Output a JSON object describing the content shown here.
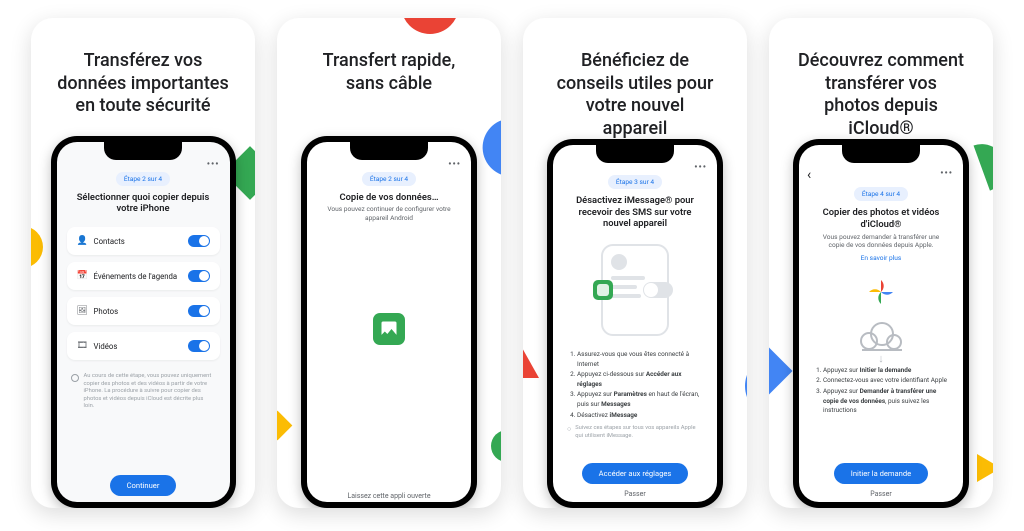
{
  "cards": [
    {
      "headline": "Transférez vos\ndonnées importantes\nen toute sécurité",
      "step": "Étape 2 sur 4",
      "title": "Sélectionner quoi copier depuis votre iPhone",
      "note": "Au cours de cette étape, vous pouvez uniquement copier des photos et des vidéos à partir de votre iPhone. La procédure à suivre pour copier des photos et vidéos depuis iCloud est décrite plus loin.",
      "cta": "Continuer",
      "toggles": [
        {
          "icon": "👤",
          "label": "Contacts",
          "on": true
        },
        {
          "icon": "📅",
          "label": "Événements de l'agenda",
          "on": true
        },
        {
          "icon": "🖼",
          "label": "Photos",
          "on": true
        },
        {
          "icon": "🎞",
          "label": "Vidéos",
          "on": true
        }
      ]
    },
    {
      "headline": "Transfert rapide,\nsans câble",
      "step": "Étape 2 sur 4",
      "title": "Copie de vos données…",
      "sub": "Vous pouvez continuer de configurer votre appareil Android",
      "bottom": "Laissez cette appli ouverte"
    },
    {
      "headline": "Bénéficiez de\nconseils utiles pour\nvotre nouvel\nappareil",
      "step": "Étape 3 sur 4",
      "title": "Désactivez iMessage® pour recevoir des SMS sur votre nouvel appareil",
      "list": [
        "Assurez-vous que vous êtes connecté à Internet",
        "Appuyez ci-dessous sur <b>Accéder aux réglages</b>",
        "Appuyez sur <b>Paramètres</b> en haut de l'écran, puis sur <b>Messages</b>",
        "Désactivez <b>iMessage</b>"
      ],
      "subnote": "Suivez ces étapes sur tous vos appareils Apple qui utilisent iMessage.",
      "cta": "Accéder aux réglages",
      "skip": "Passer"
    },
    {
      "headline": "Découvrez comment\ntransférer vos\nphotos depuis\niCloud®",
      "step": "Étape 4 sur 4",
      "title": "Copier des photos et vidéos d'iCloud®",
      "sub": "Vous pouvez demander à transférer une copie de vos données depuis Apple.",
      "link": "En savoir plus",
      "list": [
        "Appuyez sur <b>Initier la demande</b>",
        "Connectez-vous avec votre identifiant Apple",
        "Appuyez sur <b>Demander à transférer une copie de vos données</b>, puis suivez les instructions"
      ],
      "cta": "Initier la demande",
      "skip": "Passer"
    }
  ]
}
